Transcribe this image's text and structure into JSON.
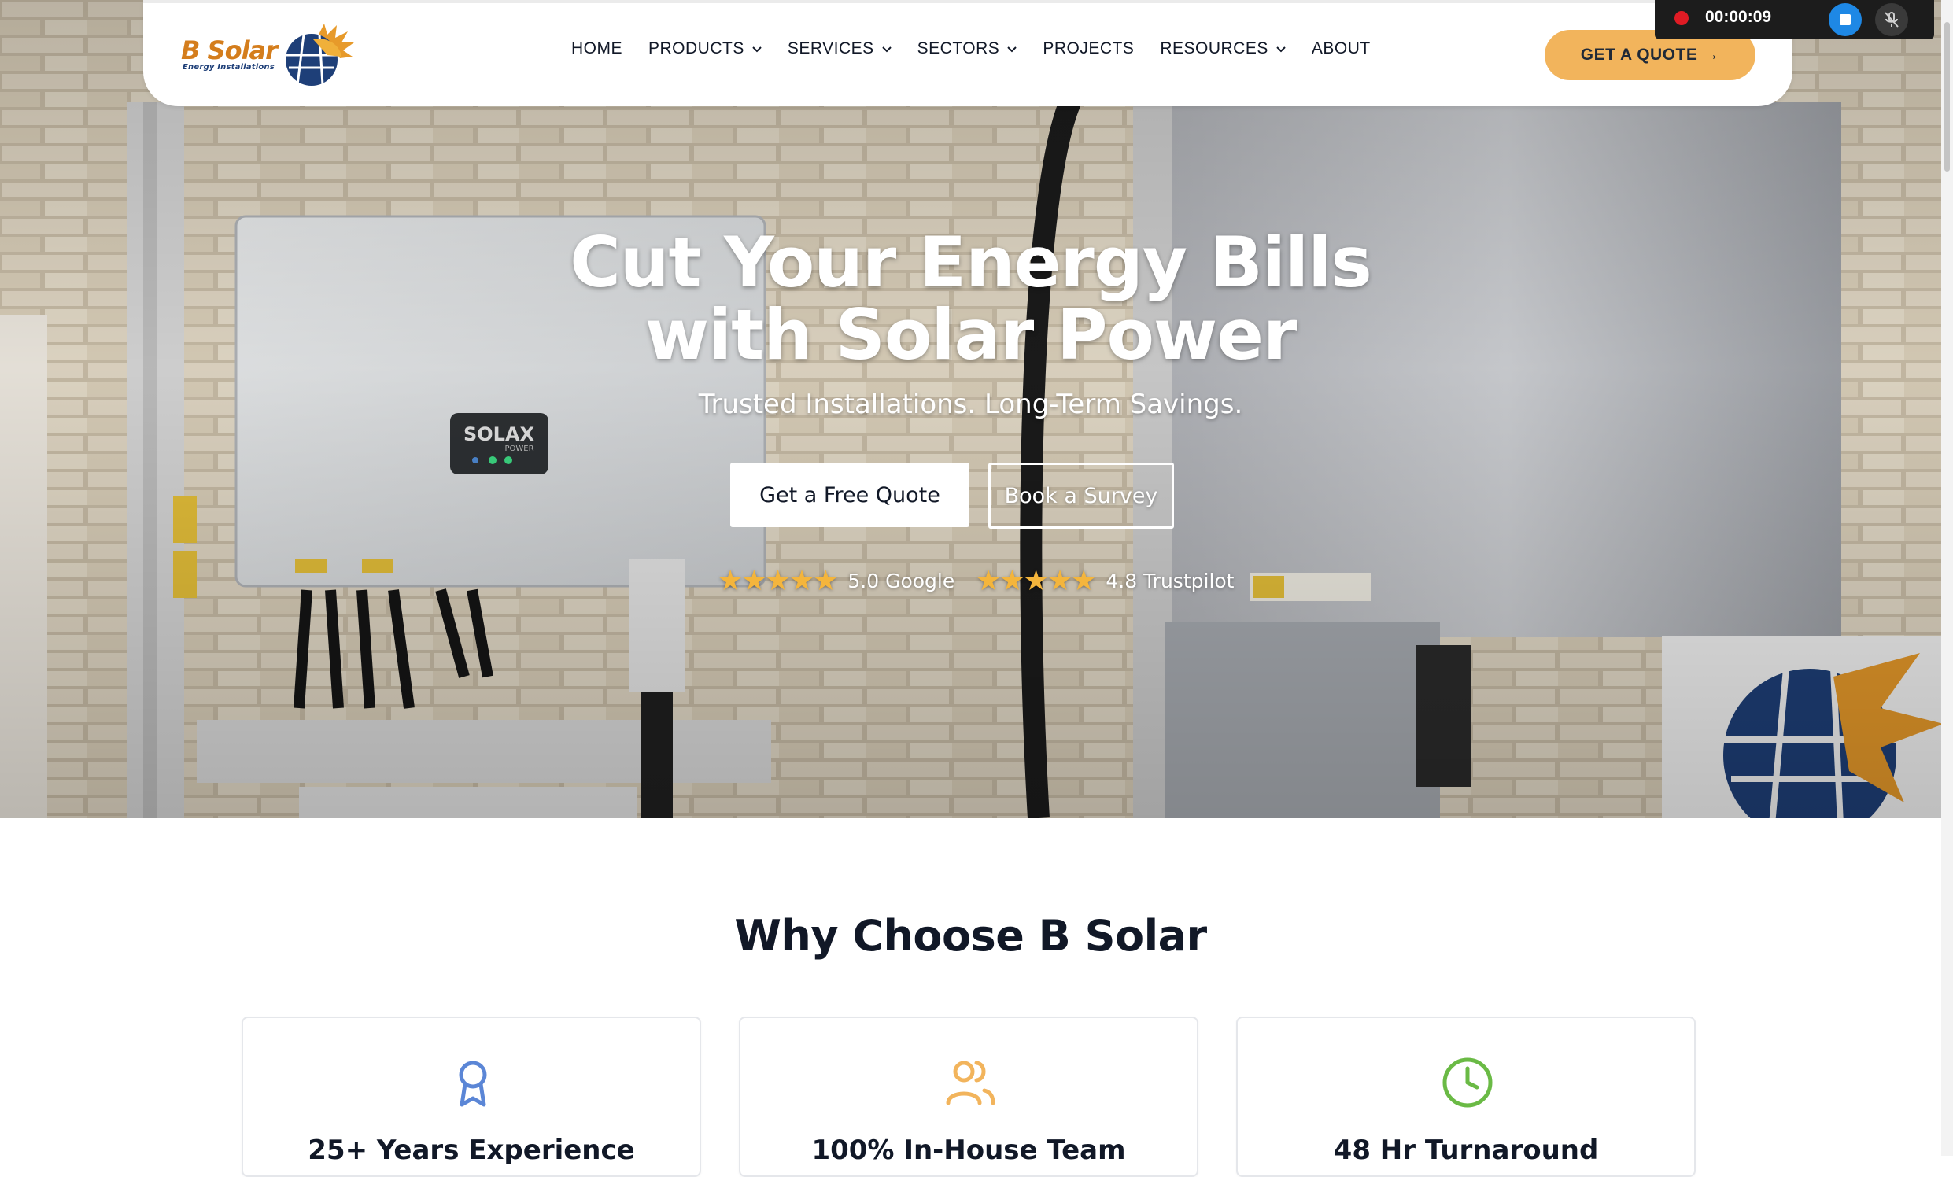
{
  "header": {
    "logo": {
      "name": "B Solar",
      "tagline": "Energy Installations"
    },
    "nav": [
      {
        "label": "HOME",
        "dropdown": false
      },
      {
        "label": "PRODUCTS",
        "dropdown": true
      },
      {
        "label": "SERVICES",
        "dropdown": true
      },
      {
        "label": "SECTORS",
        "dropdown": true
      },
      {
        "label": "PROJECTS",
        "dropdown": false
      },
      {
        "label": "RESOURCES",
        "dropdown": true
      },
      {
        "label": "ABOUT",
        "dropdown": false
      }
    ],
    "cta_label": "GET A QUOTE →"
  },
  "hero": {
    "title_line1": "Cut Your Energy Bills",
    "title_line2": "with Solar Power",
    "subtitle": "Trusted Installations. Long-Term Savings.",
    "primary_button": "Get a Free Quote",
    "secondary_button": "Book a Survey",
    "ratings": [
      {
        "stars": "★★★★★",
        "label": "5.0 Google",
        "value": 5.0
      },
      {
        "stars": "★★★★★",
        "label": "4.8 Trustpilot",
        "value": 4.8
      }
    ],
    "inverter_brand": "SOLAX",
    "inverter_sub": "POWER"
  },
  "recorder": {
    "timer": "00:00:09",
    "icons": [
      "record-icon",
      "stop-icon",
      "mic-muted-icon"
    ]
  },
  "why": {
    "title": "Why Choose B Solar",
    "cards": [
      {
        "title": "25+ Years Experience",
        "icon": "award-ribbon-icon",
        "color": "#5b86d6"
      },
      {
        "title": "100% In-House Team",
        "icon": "users-icon",
        "color": "#f2b45c"
      },
      {
        "title": "48 Hr Turnaround",
        "icon": "clock-icon",
        "color": "#6aba45"
      }
    ]
  },
  "colors": {
    "accent": "#f2b45c",
    "brand_orange": "#d47d1c",
    "brand_navy": "#1e3f78",
    "text_dark": "#111827",
    "star": "#f4b53c"
  }
}
